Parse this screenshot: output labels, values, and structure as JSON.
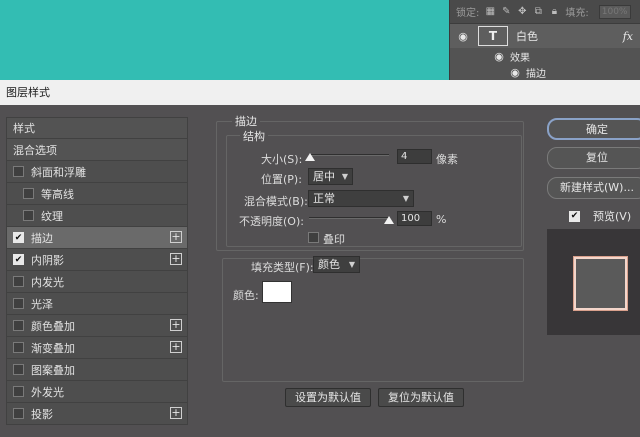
{
  "layers_panel": {
    "lock_label": "锁定:",
    "fill_label": "填充:",
    "fill_value": "100%",
    "layer_name": "白色",
    "fx_label": "fx",
    "effects_label": "效果",
    "stroke_effect_label": "描边"
  },
  "dialog": {
    "title": "图层样式"
  },
  "styles_list": {
    "items": [
      {
        "label": "样式",
        "has_checkbox": false,
        "checked": false,
        "indent": false,
        "plus": false
      },
      {
        "label": "混合选项",
        "has_checkbox": false,
        "checked": false,
        "indent": false,
        "plus": false
      },
      {
        "label": "斜面和浮雕",
        "has_checkbox": true,
        "checked": false,
        "indent": false,
        "plus": false
      },
      {
        "label": "等高线",
        "has_checkbox": true,
        "checked": false,
        "indent": true,
        "plus": false
      },
      {
        "label": "纹理",
        "has_checkbox": true,
        "checked": false,
        "indent": true,
        "plus": false
      },
      {
        "label": "描边",
        "has_checkbox": true,
        "checked": true,
        "indent": false,
        "plus": true
      },
      {
        "label": "内阴影",
        "has_checkbox": true,
        "checked": true,
        "indent": false,
        "plus": true
      },
      {
        "label": "内发光",
        "has_checkbox": true,
        "checked": false,
        "indent": false,
        "plus": false
      },
      {
        "label": "光泽",
        "has_checkbox": true,
        "checked": false,
        "indent": false,
        "plus": false
      },
      {
        "label": "颜色叠加",
        "has_checkbox": true,
        "checked": false,
        "indent": false,
        "plus": true
      },
      {
        "label": "渐变叠加",
        "has_checkbox": true,
        "checked": false,
        "indent": false,
        "plus": true
      },
      {
        "label": "图案叠加",
        "has_checkbox": true,
        "checked": false,
        "indent": false,
        "plus": false
      },
      {
        "label": "外发光",
        "has_checkbox": true,
        "checked": false,
        "indent": false,
        "plus": false
      },
      {
        "label": "投影",
        "has_checkbox": true,
        "checked": false,
        "indent": false,
        "plus": true
      }
    ]
  },
  "stroke": {
    "section_title": "描边",
    "structure_title": "结构",
    "size_label": "大小(S):",
    "size_value": "4",
    "size_unit": "像素",
    "position_label": "位置(P):",
    "position_value": "居中",
    "blend_label": "混合模式(B):",
    "blend_value": "正常",
    "opacity_label": "不透明度(O):",
    "opacity_value": "100",
    "opacity_unit": "%",
    "overprint_label": "叠印",
    "fill_type_label": "填充类型(F):",
    "fill_type_value": "颜色",
    "color_label": "颜色:",
    "color_value": "#ffffff",
    "set_default_button": "设置为默认值",
    "reset_default_button": "复位为默认值"
  },
  "right_panel": {
    "ok_button": "确定",
    "reset_button": "复位",
    "new_style_button": "新建样式(W)...",
    "preview_label": "预览(V)",
    "preview_checked": true
  }
}
